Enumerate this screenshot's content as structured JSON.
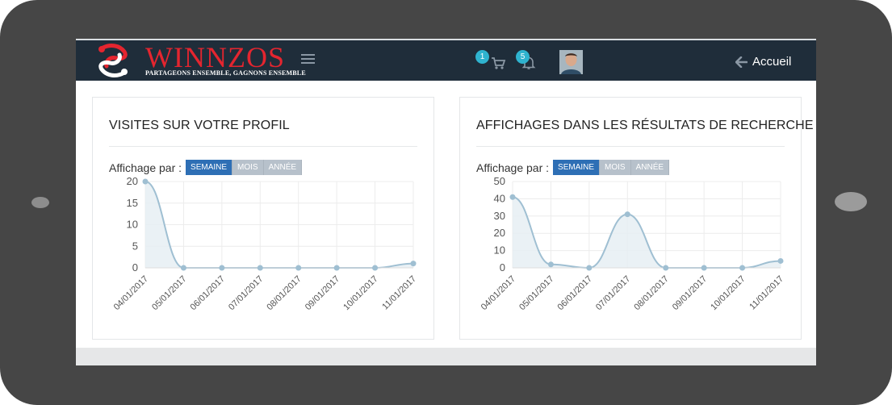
{
  "app": {
    "brand": "WINNZOS",
    "tagline": "PARTAGEONS ENSEMBLE, GAGNONS ENSEMBLE"
  },
  "navbar": {
    "cart_count": "1",
    "notifications_count": "5",
    "home_label": "Accueil"
  },
  "colors": {
    "navbar_bg": "#1f2d3a",
    "brand_red": "#e4252f",
    "badge": "#2fb3cf",
    "active_button": "#2e6fb5",
    "chart_line": "#9fbfd2"
  },
  "cards": [
    {
      "title": "VISITES SUR VOTRE PROFIL",
      "filter_label": "Affichage par :",
      "buttons": [
        "SEMAINE",
        "MOIS",
        "ANNÉE"
      ],
      "active": "SEMAINE"
    },
    {
      "title": "AFFICHAGES DANS LES RÉSULTATS DE RECHERCHE",
      "filter_label": "Affichage par :",
      "buttons": [
        "SEMAINE",
        "MOIS",
        "ANNÉE"
      ],
      "active": "SEMAINE"
    }
  ],
  "chart_data": [
    {
      "type": "area",
      "categories": [
        "04/01/2017",
        "05/01/2017",
        "06/01/2017",
        "07/01/2017",
        "08/01/2017",
        "09/01/2017",
        "10/01/2017",
        "11/01/2017"
      ],
      "values": [
        20,
        0,
        0,
        0,
        0,
        0,
        0,
        1
      ],
      "ylim": [
        0,
        20
      ],
      "yticks": [
        0,
        5,
        10,
        15,
        20
      ],
      "grid": true
    },
    {
      "type": "area",
      "categories": [
        "04/01/2017",
        "05/01/2017",
        "06/01/2017",
        "07/01/2017",
        "08/01/2017",
        "09/01/2017",
        "10/01/2017",
        "11/01/2017"
      ],
      "values": [
        41,
        2,
        0,
        31,
        0,
        0,
        0,
        4
      ],
      "ylim": [
        0,
        50
      ],
      "yticks": [
        0,
        10,
        20,
        30,
        40,
        50
      ],
      "grid": true
    }
  ]
}
